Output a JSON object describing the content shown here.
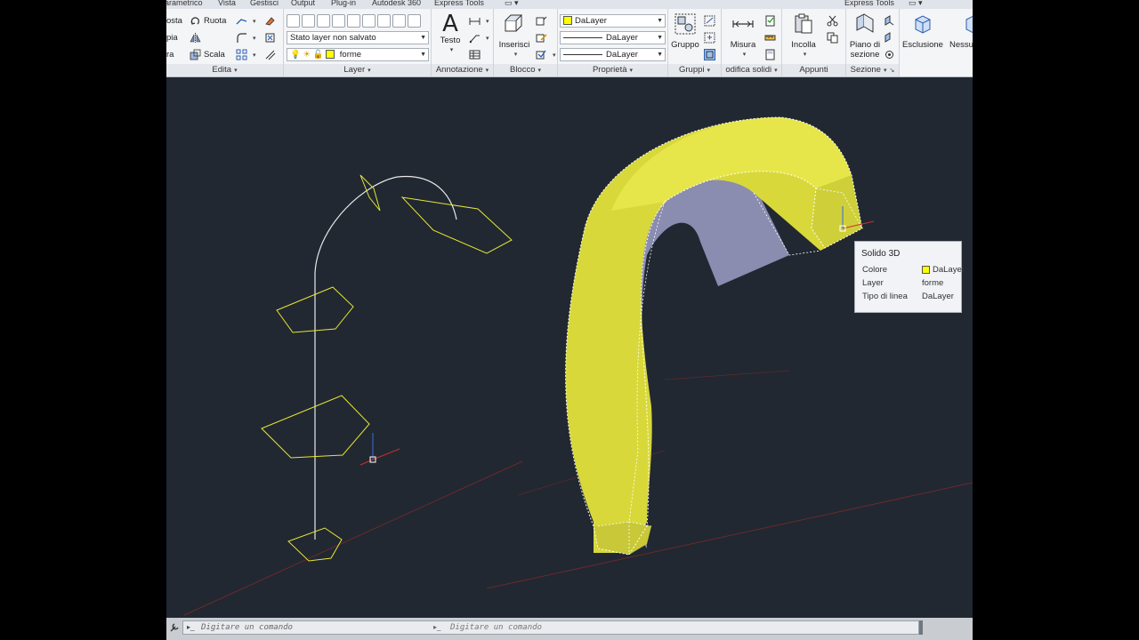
{
  "tabs": [
    "arametrico",
    "Vista",
    "Gestisci",
    "Output",
    "Plug-in",
    "Autodesk 360",
    "Express Tools",
    "Express Tools"
  ],
  "panels": {
    "edita": {
      "title": "Edita",
      "rows": [
        {
          "a": "osta",
          "b": "Ruota"
        },
        {
          "a": "pia",
          "b": ""
        },
        {
          "a": "ra",
          "b": "Scala"
        }
      ]
    },
    "layer": {
      "title": "Layer",
      "state_value": "Stato layer non salvato",
      "current_layer": "forme"
    },
    "annotazione": {
      "title": "Annotazione",
      "testo_label": "Testo"
    },
    "blocco": {
      "title": "Blocco",
      "inserisci_label": "Inserisci"
    },
    "proprieta": {
      "title": "Proprietà",
      "color_value": "DaLayer",
      "lineweight_value": "DaLayer",
      "linetype_value": "DaLayer"
    },
    "gruppi": {
      "title": "Gruppi",
      "gruppo_label": "Gruppo"
    },
    "modifica_solidi": {
      "title": "odifica solidi",
      "misura_label": "Misura"
    },
    "appunti": {
      "title": "Appunti",
      "incolla_label": "Incolla"
    },
    "sezione": {
      "title": "Sezione",
      "piano_label_1": "Piano di",
      "piano_label_2": "sezione",
      "esclusione_label": "Esclusione",
      "nessuno_label": "Nessu"
    }
  },
  "tooltip": {
    "title": "Solido 3D",
    "rows": [
      {
        "label": "Colore",
        "value": "DaLayer"
      },
      {
        "label": "Layer",
        "value": "forme"
      },
      {
        "label": "Tipo di linea",
        "value": "DaLayer"
      }
    ]
  },
  "command_line": {
    "placeholder": "Digitare un comando",
    "ghost": "Digitare un comando"
  },
  "colors": {
    "viewport_bg": "#212832",
    "profile_yellow": "#ffff00",
    "solid_yellow": "#e6e632",
    "path_white": "#e8e8e8"
  }
}
